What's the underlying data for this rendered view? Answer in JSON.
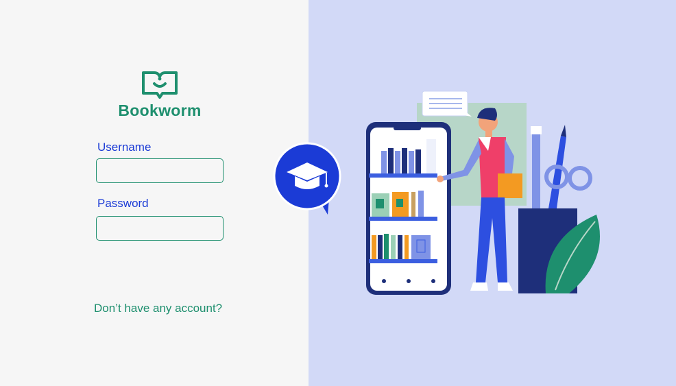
{
  "brand": {
    "name": "Bookworm",
    "logo_icon": "open-book-smile-icon",
    "color": "#1e8f6e"
  },
  "form": {
    "username_label": "Username",
    "username_value": "",
    "password_label": "Password",
    "password_value": "",
    "signup_link": "Don’t have any account?"
  },
  "badge": {
    "icon": "graduation-cap-icon",
    "color": "#1b3bd6"
  },
  "illustration": {
    "description_icon": "reader-with-phone-bookshelf-icon"
  },
  "colors": {
    "left_bg": "#f6f6f6",
    "right_bg": "#d2d9f7",
    "accent_blue": "#1b3bd6",
    "accent_green": "#1e8f6e"
  }
}
